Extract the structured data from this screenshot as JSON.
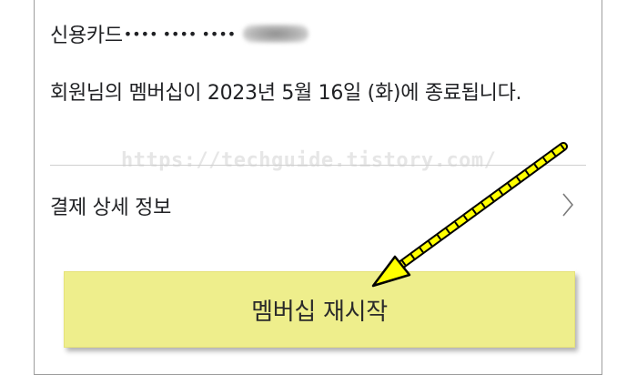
{
  "payment": {
    "method_label": "신용카드",
    "masked_number": "•••• •••• ••••"
  },
  "notice": {
    "text": "회원님의 멤버십이 2023년 5월 16일 (화)에 종료됩니다."
  },
  "watermark": {
    "text": "https://techguide.tistory.com/"
  },
  "details": {
    "label": "결제 상세 정보"
  },
  "restart": {
    "label": "멤버십 재시작"
  },
  "colors": {
    "button_bg": "#eeee8c",
    "arrow_fill": "#ffff00",
    "arrow_dash": "#000000"
  },
  "icons": {
    "detail_chevron": "chevron-right-icon",
    "annotation": "arrow-pointer-icon",
    "masked_digits": "blurred-digits"
  }
}
